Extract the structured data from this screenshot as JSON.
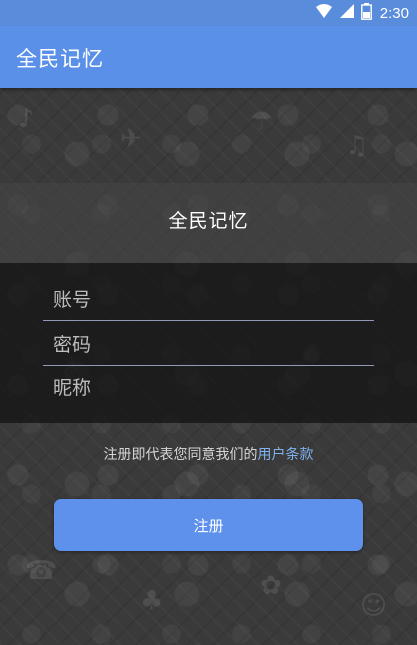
{
  "status_bar": {
    "time": "2:30",
    "icons": [
      "wifi-icon",
      "signal-icon",
      "battery-icon"
    ]
  },
  "app_bar": {
    "title": "全民记忆"
  },
  "form": {
    "title": "全民记忆",
    "account_placeholder": "账号",
    "password_placeholder": "密码",
    "nickname_placeholder": "昵称",
    "agreement_text": "注册即代表您同意我们的",
    "agreement_link": "用户条款",
    "register_label": "注册"
  },
  "colors": {
    "primary": "#5b90e8",
    "status_bar": "#5a8cdc",
    "link": "#7fb2ee"
  }
}
